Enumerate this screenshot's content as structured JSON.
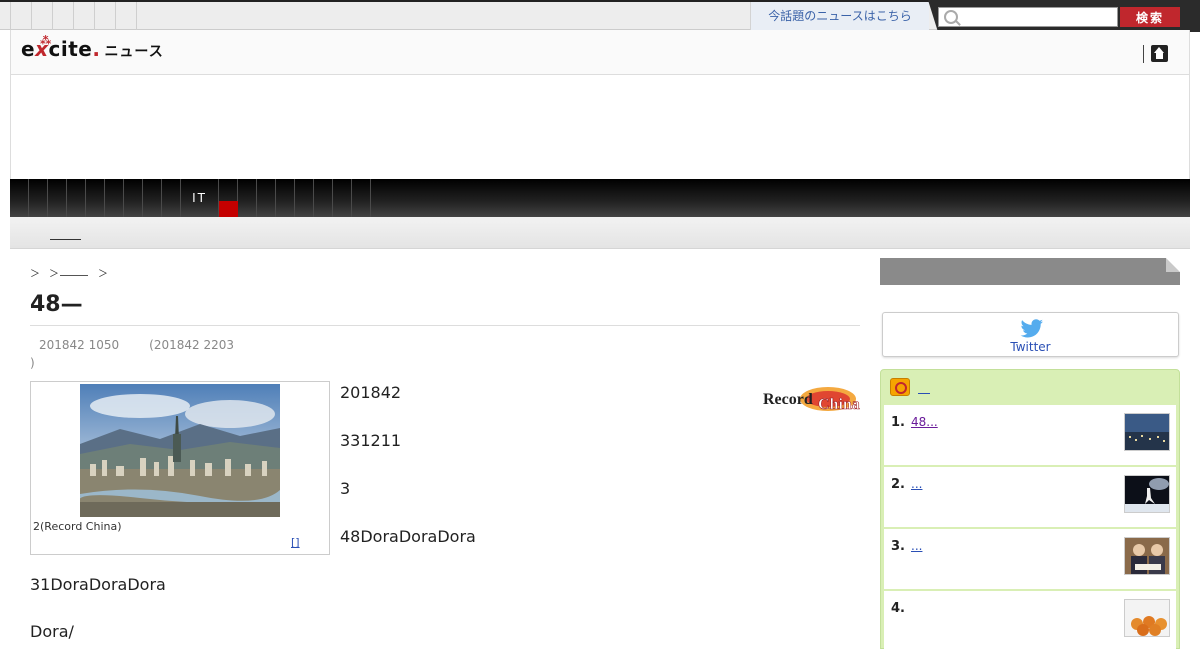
{
  "topbar": {
    "trend_link": "今話題のニュースはこちら",
    "search_placeholder": "",
    "search_button": "検索"
  },
  "logo": {
    "brand_e": "e",
    "brand_x": "x",
    "brand_rest": "cite",
    "dot": ".",
    "news": "ニュース"
  },
  "catnav": {
    "items": [
      "",
      "",
      "",
      "",
      "",
      "",
      "",
      "",
      "",
      "IT",
      "",
      "",
      "",
      "",
      "",
      "",
      "",
      ""
    ]
  },
  "breadcrumb": {
    "sep": "＞"
  },
  "article": {
    "title": "48—",
    "published": "201842 1050",
    "updated": "(201842 2203",
    "updated_close": ")",
    "photo_caption": "2(Record China)",
    "photo_more": "[]",
    "paragraphs": [
      "201842",
      "331211",
      "3",
      "48DoraDoraDora",
      "31DoraDoraDora",
      "Dora/"
    ],
    "source_logo": "Record China"
  },
  "sidebar": {
    "twitter_label": "Twitter",
    "ranking": {
      "title": "",
      "items": [
        {
          "num": "1.",
          "text": "48...",
          "thumb": "city-photo"
        },
        {
          "num": "2.",
          "text": "...",
          "thumb": "skater-photo"
        },
        {
          "num": "3.",
          "text": "...",
          "thumb": "people-photo"
        },
        {
          "num": "4.",
          "text": "",
          "thumb": "food-photo"
        }
      ]
    }
  },
  "colors": {
    "accent_red": "#c0272d",
    "link_blue": "#2a4fb5",
    "ranking_bg": "#d9efb5"
  }
}
